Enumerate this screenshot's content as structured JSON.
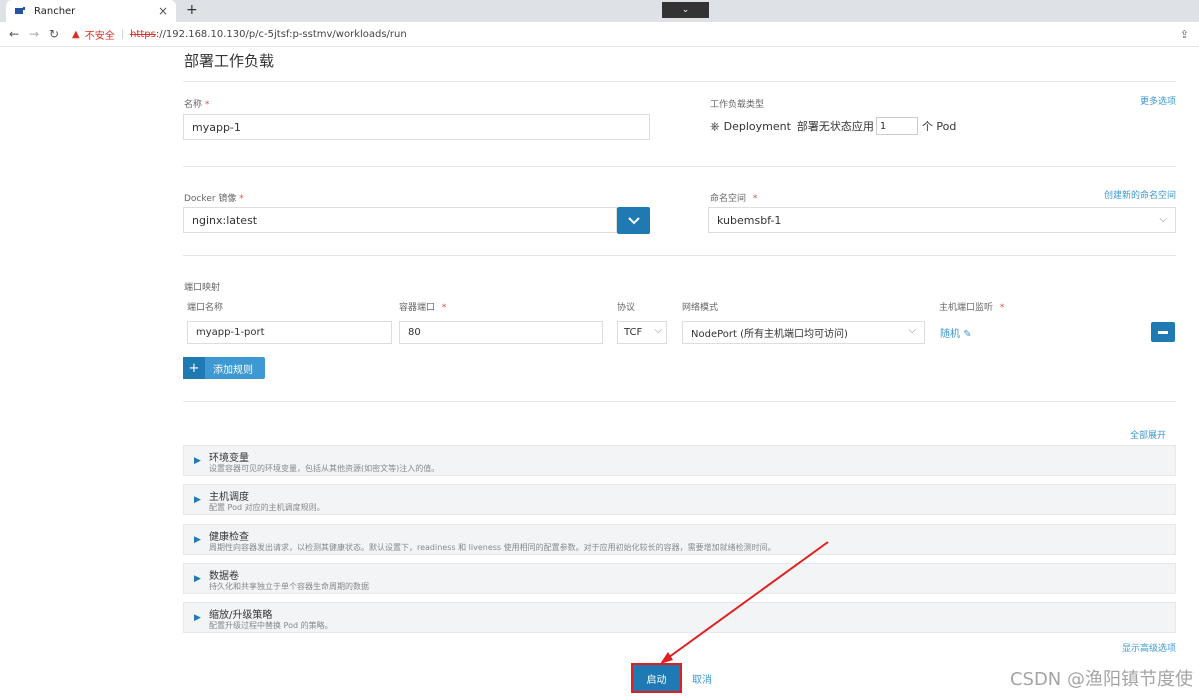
{
  "browser": {
    "tab_title": "Rancher",
    "tab_close": "×",
    "new_tab": "+",
    "tab_search": "⌄",
    "insecure_label": "不安全",
    "url_scheme": "https",
    "url_rest": "://192.168.10.130/p/c-5jtsf:p-sstmv/workloads/run"
  },
  "page": {
    "title": "部署工作负载",
    "name_label": "名称",
    "name_value": "myapp-1",
    "workload_type_label": "工作负载类型",
    "more_options": "更多选项",
    "workload_kind": "Deployment",
    "workload_desc": "部署无状态应用",
    "replicas": "1",
    "pod_unit": "个 Pod",
    "image_label": "Docker 镜像",
    "image_value": "nginx:latest",
    "namespace_label": "命名空间",
    "create_namespace": "创建新的命名空间",
    "namespace_value": "kubemsbf-1",
    "port_mapping_label": "端口映射",
    "port_cols": {
      "name": "端口名称",
      "container_port": "容器端口",
      "protocol": "协议",
      "network_mode": "网络模式",
      "host_port": "主机端口监听"
    },
    "port_row": {
      "name": "myapp-1-port",
      "container_port": "80",
      "protocol": "TCF",
      "network_mode": "NodePort (所有主机端口均可访问)",
      "host_port": "随机"
    },
    "add_rule": "添加规则",
    "expand_all": "全部展开",
    "sections": [
      {
        "title": "环境变量",
        "desc": "设置容器可见的环境变量，包括从其他资源(如密文等)注入的值。"
      },
      {
        "title": "主机调度",
        "desc": "配置 Pod 对应的主机调度规则。"
      },
      {
        "title": "健康检查",
        "desc": "周期性向容器发出请求，以检测其健康状态。默认设置下，readiness 和 liveness 使用相同的配置参数。对于应用初始化较长的容器，需要增加就绪检测时间。"
      },
      {
        "title": "数据卷",
        "desc": "持久化和共享独立于单个容器生命周期的数据"
      },
      {
        "title": "缩放/升级策略",
        "desc": "配置升级过程中替换 Pod 的策略。"
      }
    ],
    "show_advanced": "显示高级选项",
    "launch": "启动",
    "cancel": "取消"
  },
  "watermark": "CSDN @渔阳镇节度使",
  "colors": {
    "primary": "#1f7ab4",
    "link": "#3d98d3",
    "annotation": "#e02020"
  }
}
